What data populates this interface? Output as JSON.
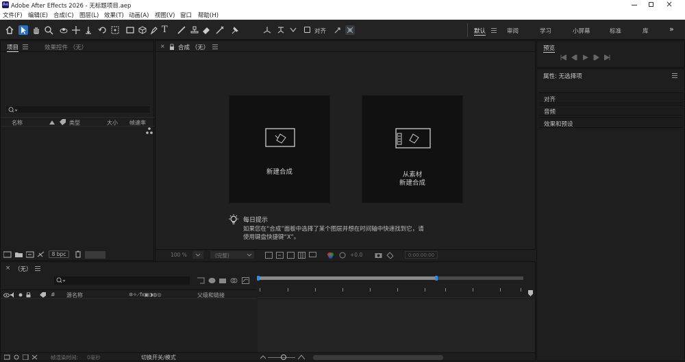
{
  "window": {
    "title": "Adobe After Effects 2026 - 无标题项目.aep",
    "app_icon": "Ae"
  },
  "menu": [
    "文件(F)",
    "编辑(E)",
    "合成(C)",
    "图层(L)",
    "效果(T)",
    "动画(A)",
    "视图(V)",
    "窗口",
    "帮助(H)"
  ],
  "toolbar": {
    "align_label": "对齐",
    "workspaces": [
      "默认",
      "审阅",
      "学习",
      "小屏幕",
      "标准",
      "库"
    ],
    "active_workspace": "默认",
    "overflow": "»"
  },
  "project_panel": {
    "tabs": [
      "项目",
      "效果控件 （无）"
    ],
    "search_placeholder": "",
    "columns": [
      "名称",
      "类型",
      "大小",
      "帧速率"
    ],
    "bpc": "8 bpc"
  },
  "composition_panel": {
    "tab": "合成 （无）",
    "cards": [
      {
        "label": "新建合成"
      },
      {
        "label_lines": [
          "从素材",
          "新建合成"
        ]
      }
    ],
    "tip_title": "每日提示",
    "tip_lines": [
      "如果您在“合成”面板中选择了某个图层并想在时间轴中快速找到它，请",
      "使用键盘快捷键“X”。"
    ],
    "footer": {
      "zoom": "100 %",
      "quality": "(完整)",
      "exposure": "+0.0",
      "timecode": "0:00:00:00"
    }
  },
  "right_panels": {
    "preview_title": "预览",
    "properties_title": "属性: 无选择项",
    "sections": [
      "对齐",
      "音频",
      "效果和预设"
    ]
  },
  "timeline": {
    "tab": "（无）",
    "columns": [
      "源名称",
      "父级和链接"
    ],
    "footer": {
      "frame_render_label": "帧渲染时间:",
      "frame_render_value": "0毫秒",
      "toggle_label": "切换开关/模式"
    }
  },
  "colors": {
    "accent": "#2d8ceb",
    "panel_bg": "#1e1e1e",
    "card_bg": "#111111",
    "window_bar": "#ffffff"
  }
}
